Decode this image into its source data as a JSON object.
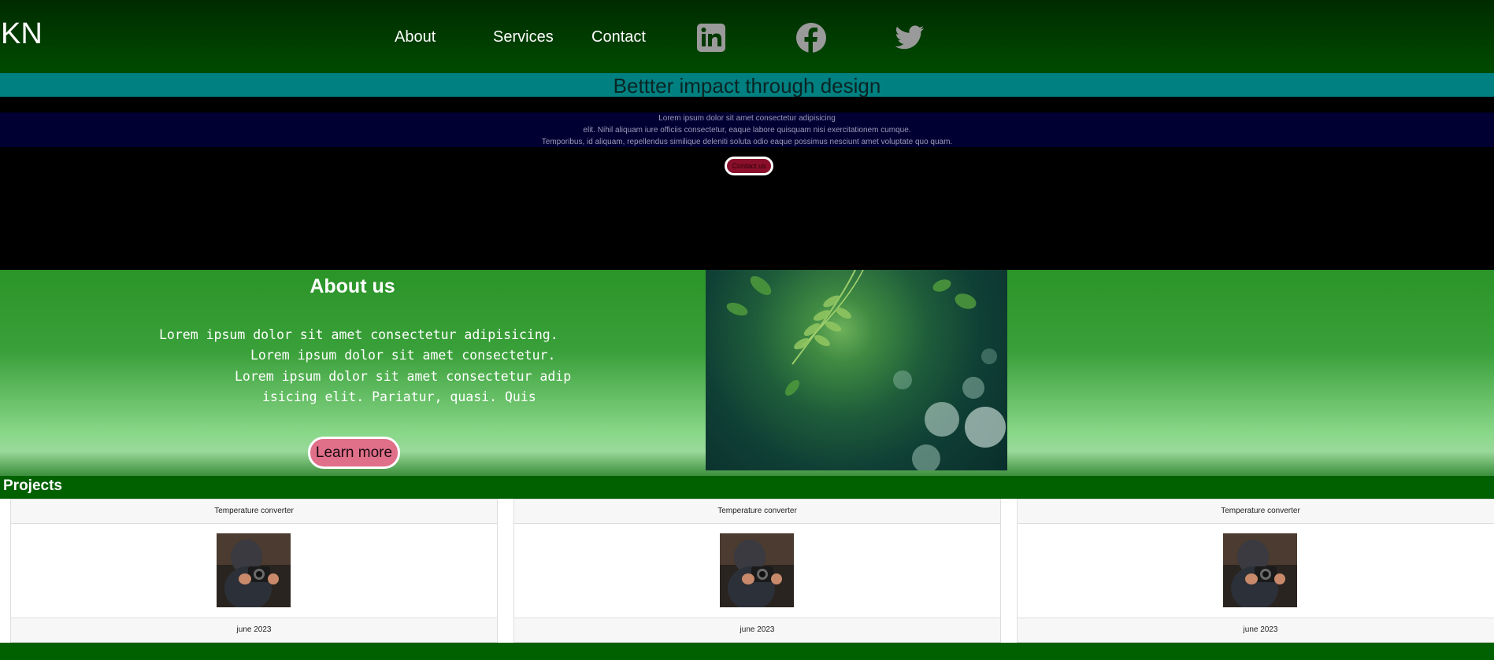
{
  "nav": {
    "logo": "KN",
    "links": [
      "About",
      "Services",
      "Contact"
    ],
    "social": [
      "linkedin-icon",
      "facebook-icon",
      "twitter-icon"
    ],
    "icon_color": "#9a9a9a"
  },
  "hero": {
    "title": "Bettter impact through design",
    "lines": [
      "Lorem ipsum dolor sit amet consectetur adipisicing",
      "elit. Nihil aliquam iure officiis consectetur, eaque labore quisquam nisi exercitationem cumque.",
      "Temporibus, id aliquam, repellendus similique deleniti soluta odio eaque possimus nesciunt amet voluptate quo quam."
    ],
    "button": "Contact us"
  },
  "about": {
    "title": "About us",
    "lines": [
      "Lorem ipsum dolor sit amet consectetur adipisicing.",
      "Lorem ipsum dolor sit amet consectetur.",
      "Lorem ipsum dolor sit amet consectetur adip",
      "isicing elit. Pariatur, quasi. Quis"
    ],
    "button": "Learn more"
  },
  "projects": {
    "title": "Projects",
    "cards": [
      {
        "title": "Temperature converter",
        "date": "june 2023"
      },
      {
        "title": "Temperature converter",
        "date": "june 2023"
      },
      {
        "title": "Temperature converter",
        "date": "june 2023"
      }
    ]
  }
}
